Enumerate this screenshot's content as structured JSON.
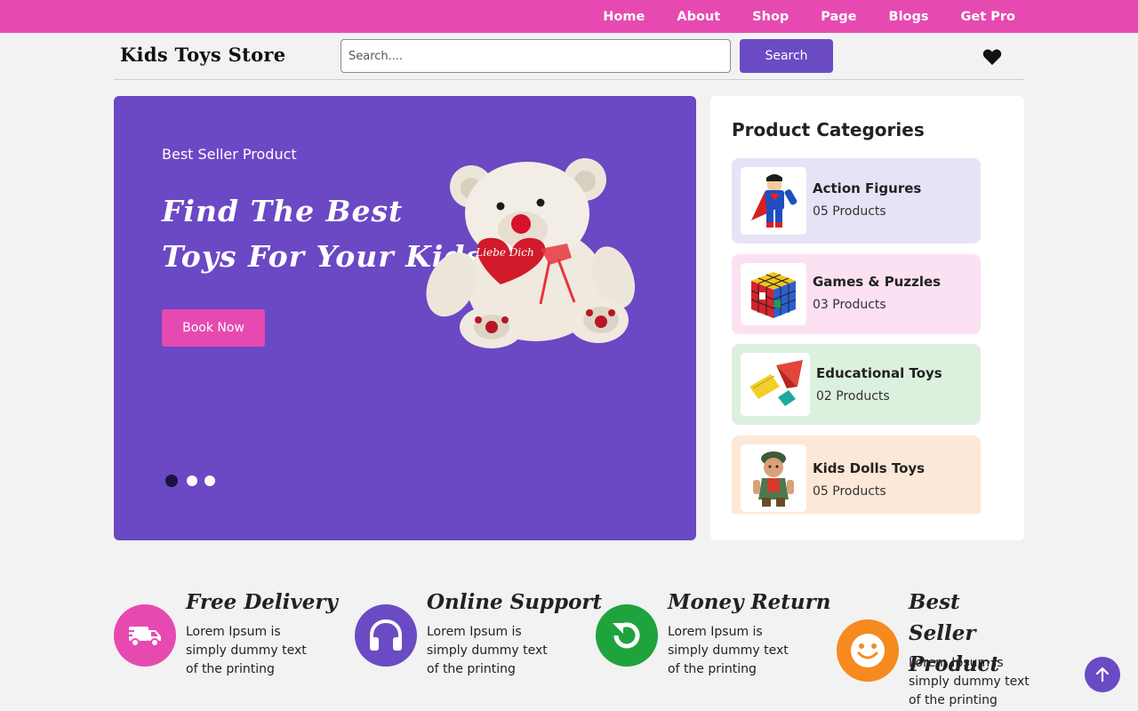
{
  "nav": {
    "items": [
      {
        "label": "Home"
      },
      {
        "label": "About"
      },
      {
        "label": "Shop"
      },
      {
        "label": "Page"
      },
      {
        "label": "Blogs"
      },
      {
        "label": "Get Pro"
      }
    ]
  },
  "header": {
    "logo": "Kids Toys Store",
    "search_placeholder": "Search....",
    "search_button": "Search",
    "wishlist_icon": "heart-icon"
  },
  "hero": {
    "subtitle": "Best Seller Product",
    "title_line1": "Find The Best",
    "title_line2": "Toys For Your Kids",
    "button": "Book Now",
    "heart_text": "Liebe Dich",
    "slides": 3,
    "active_slide": 1
  },
  "categories": {
    "title": "Product Categories",
    "items": [
      {
        "name": "Action Figures",
        "count": "05 Products",
        "bg": "#e8e2f7"
      },
      {
        "name": "Games & Puzzles",
        "count": "03 Products",
        "bg": "#fbe1f2"
      },
      {
        "name": "Educational Toys",
        "count": "02 Products",
        "bg": "#dcf0de"
      },
      {
        "name": "Kids Dolls Toys",
        "count": "05 Products",
        "bg": "#fde8d7"
      }
    ]
  },
  "features": [
    {
      "title": "Free Delivery",
      "text": "Lorem Ipsum is simply dummy text of the printing",
      "icon": "truck-icon",
      "color": "#e64ab0"
    },
    {
      "title": "Online Support",
      "text": "Lorem Ipsum is simply dummy text of the printing",
      "icon": "headphones-icon",
      "color": "#6a4bc4"
    },
    {
      "title": "Money Return",
      "text": "Lorem Ipsum is simply dummy text of the printing",
      "icon": "refresh-icon",
      "color": "#1fa33c"
    },
    {
      "title": "Best Seller Product",
      "text": "Lorem Ipsum is simply dummy text of the printing",
      "icon": "smile-icon",
      "color": "#f58a1f"
    }
  ],
  "colors": {
    "brand_pink": "#e64ab0",
    "brand_purple": "#6a4bc4",
    "hero_bg": "#6b48c4"
  }
}
